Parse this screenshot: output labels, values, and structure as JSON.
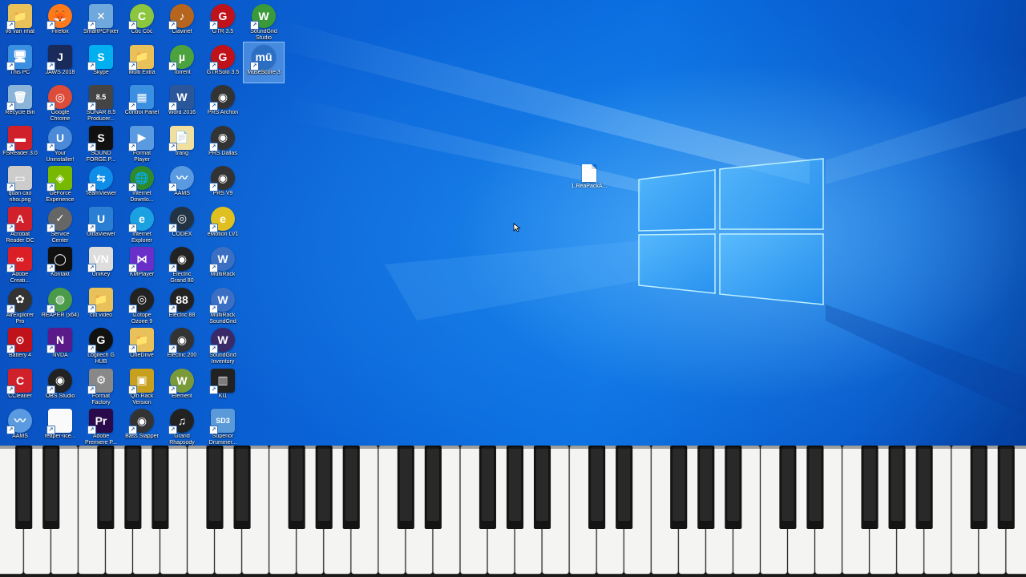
{
  "colors": {
    "desktop_blue": "#0a63d6",
    "logo_glow": "#8fd4ff",
    "white_key": "#f4f4f2",
    "black_key": "#141414"
  },
  "desktop_icons": [
    {
      "label": "vo van nhat",
      "icon": "user-folder-icon",
      "color": "#e8c15a",
      "glyph": "📁"
    },
    {
      "label": "Firefox",
      "icon": "firefox-icon",
      "color": "#ff7a1a",
      "glyph": "🦊",
      "round": true
    },
    {
      "label": "SmartPCFixer",
      "icon": "smartpcfixer-icon",
      "color": "#6fa8dc",
      "glyph": "✕"
    },
    {
      "label": "Cốc Cốc",
      "icon": "coccoc-icon",
      "color": "#8cc63f",
      "glyph": "C",
      "round": true
    },
    {
      "label": "Clavinet",
      "icon": "clavinet-icon",
      "color": "#b5651d",
      "glyph": "♪",
      "round": true
    },
    {
      "label": "GTR 3.5",
      "icon": "gtr-icon",
      "color": "#c0121a",
      "glyph": "G",
      "round": true
    },
    {
      "label": "SoundGrid",
      "label2": "Studio",
      "icon": "soundgrid-studio-icon",
      "color": "#3a9a3a",
      "glyph": "W",
      "round": true
    },
    {
      "label": "This PC",
      "icon": "this-pc-icon",
      "color": "#3b8fe0",
      "glyph": "🖥"
    },
    {
      "label": "JAWS 2018",
      "icon": "jaws-icon",
      "color": "#1a2a5a",
      "glyph": "J"
    },
    {
      "label": "Skype",
      "icon": "skype-icon",
      "color": "#00aff0",
      "glyph": "S"
    },
    {
      "label": "Multi Extra",
      "icon": "multi-extra-icon",
      "color": "#e8c15a",
      "glyph": "📁"
    },
    {
      "label": "Torrent",
      "icon": "utorrent-icon",
      "color": "#4ca33d",
      "glyph": "µ",
      "round": true
    },
    {
      "label": "GTRSolo 3.5",
      "icon": "gtrsolo-icon",
      "color": "#c0121a",
      "glyph": "G",
      "round": true
    },
    {
      "label": "MuseScore 3",
      "icon": "musescore-icon",
      "color": "#2a6fc4",
      "glyph": "mū",
      "round": true,
      "selected": true
    },
    {
      "label": "Recycle Bin",
      "icon": "recycle-bin-icon",
      "color": "#8ab4d8",
      "glyph": "🗑"
    },
    {
      "label": "Google",
      "label2": "Chrome",
      "icon": "chrome-icon",
      "color": "#dd4b39",
      "glyph": "◎",
      "round": true
    },
    {
      "label": "SONAR 8.5",
      "label2": "Producer...",
      "icon": "sonar-icon",
      "color": "#444",
      "glyph": "8.5"
    },
    {
      "label": "Control Panel",
      "icon": "control-panel-icon",
      "color": "#3b8fe0",
      "glyph": "▦"
    },
    {
      "label": "Word 2016",
      "icon": "word-icon",
      "color": "#2b579a",
      "glyph": "W"
    },
    {
      "label": "PRS Archon",
      "icon": "prs-archon-icon",
      "color": "#333",
      "glyph": "◉",
      "round": true
    },
    {
      "label": "FSReader 3.0",
      "icon": "fsreader-icon",
      "color": "#d0202a",
      "glyph": "▬"
    },
    {
      "label": "Your",
      "label2": "Uninstaller!",
      "icon": "uninstaller-icon",
      "color": "#4a8ad8",
      "glyph": "U",
      "round": true
    },
    {
      "label": "SOUND",
      "label2": "FORGE P...",
      "icon": "soundforge-icon",
      "color": "#111",
      "glyph": "S"
    },
    {
      "label": "Format",
      "label2": "Player",
      "icon": "format-player-icon",
      "color": "#5a9ae0",
      "glyph": "▶"
    },
    {
      "label": "trang",
      "icon": "trang-folder-icon",
      "color": "#f1dfa0",
      "glyph": "📄"
    },
    {
      "label": "PRS Dallas",
      "icon": "prs-dallas-icon",
      "color": "#333",
      "glyph": "◉",
      "round": true
    },
    {
      "label": "quan cao",
      "label2": "nhoi.png",
      "icon": "image-file-icon",
      "color": "#ccc",
      "glyph": "▭"
    },
    {
      "label": "GeForce",
      "label2": "Experience",
      "icon": "geforce-icon",
      "color": "#76b900",
      "glyph": "◈"
    },
    {
      "label": "TeamViewer",
      "icon": "teamviewer-icon",
      "color": "#0e8ee9",
      "glyph": "⇆",
      "round": true
    },
    {
      "label": "Internet",
      "label2": "Downlo...",
      "icon": "idm-icon",
      "color": "#2d8b2d",
      "glyph": "🌐",
      "round": true
    },
    {
      "label": "AAMS",
      "icon": "aams-icon",
      "color": "#5a9ae0",
      "glyph": "〰",
      "round": true
    },
    {
      "label": "PRS V9",
      "icon": "prs-v9-icon",
      "color": "#333",
      "glyph": "◉",
      "round": true
    },
    {
      "label": "Acrobat",
      "label2": "Reader DC",
      "icon": "acrobat-icon",
      "color": "#d0202a",
      "glyph": "A"
    },
    {
      "label": "Service",
      "label2": "Center",
      "icon": "service-center-icon",
      "color": "#666",
      "glyph": "✓",
      "round": true
    },
    {
      "label": "UltraViewer",
      "icon": "ultraviewer-icon",
      "color": "#2a7fd4",
      "glyph": "U"
    },
    {
      "label": "Internet",
      "label2": "Explorer",
      "icon": "ie-icon",
      "color": "#1ba1e2",
      "glyph": "e",
      "round": true
    },
    {
      "label": "CODEX",
      "icon": "codex-icon",
      "color": "#234",
      "glyph": "◎",
      "round": true
    },
    {
      "label": "eMotion LV1",
      "icon": "emotion-icon",
      "color": "#e0c020",
      "glyph": "e",
      "round": true
    },
    {
      "label": "Adobe",
      "label2": "Creati...",
      "icon": "creative-cloud-icon",
      "color": "#da1f26",
      "glyph": "∞"
    },
    {
      "label": "Kontakt",
      "icon": "kontakt-icon",
      "color": "#111",
      "glyph": "◯"
    },
    {
      "label": "UniKey",
      "icon": "unikey-icon",
      "color": "#ddd",
      "glyph": "VN"
    },
    {
      "label": "KMPlayer",
      "icon": "kmplayer-icon",
      "color": "#6b2fc9",
      "glyph": "⋈"
    },
    {
      "label": "Electric",
      "label2": "Grand 80",
      "icon": "electric-grand-icon",
      "color": "#222",
      "glyph": "◉",
      "round": true
    },
    {
      "label": "MultiRack",
      "icon": "multirack-icon",
      "color": "#3a6fc4",
      "glyph": "W",
      "round": true
    },
    {
      "label": "AirExplorer",
      "label2": "Pro",
      "icon": "airexplorer-icon",
      "color": "#333",
      "glyph": "✿",
      "round": true
    },
    {
      "label": "REAPER (x64)",
      "icon": "reaper-icon",
      "color": "#4a9a4a",
      "glyph": "◍",
      "round": true
    },
    {
      "label": "cut video",
      "icon": "cut-video-folder-icon",
      "color": "#e8c15a",
      "glyph": "📁"
    },
    {
      "label": "iZotope",
      "label2": "Ozone 9",
      "icon": "ozone-icon",
      "color": "#222",
      "glyph": "◎",
      "round": true
    },
    {
      "label": "Electric 88",
      "icon": "electric-88-icon",
      "color": "#222",
      "glyph": "88",
      "round": true
    },
    {
      "label": "MultiRack",
      "label2": "SoundGrid",
      "icon": "multirack-soundgrid-icon",
      "color": "#3a6fc4",
      "glyph": "W",
      "round": true
    },
    {
      "label": "Battery 4",
      "icon": "battery-icon",
      "color": "#c0121a",
      "glyph": "⊙"
    },
    {
      "label": "NVDA",
      "icon": "nvda-icon",
      "color": "#5a1a8a",
      "glyph": "N"
    },
    {
      "label": "Logitech G",
      "label2": "HUB",
      "icon": "logitech-icon",
      "color": "#111",
      "glyph": "G",
      "round": true
    },
    {
      "label": "OneDrive",
      "icon": "onedrive-folder-icon",
      "color": "#e8c15a",
      "glyph": "📁"
    },
    {
      "label": "Electric 200",
      "icon": "electric-200-icon",
      "color": "#333",
      "glyph": "◉",
      "round": true
    },
    {
      "label": "SoundGrid",
      "label2": "Inventory",
      "icon": "soundgrid-inventory-icon",
      "color": "#3a2a6a",
      "glyph": "W",
      "round": true
    },
    {
      "label": "CCleaner",
      "icon": "ccleaner-icon",
      "color": "#d0202a",
      "glyph": "C"
    },
    {
      "label": "OBS Studio",
      "icon": "obs-icon",
      "color": "#222",
      "glyph": "◉",
      "round": true
    },
    {
      "label": "Format",
      "label2": "Factory",
      "icon": "format-factory-icon",
      "color": "#888",
      "glyph": "⚙"
    },
    {
      "label": "Qin Rack",
      "label2": "Version",
      "icon": "qin-rack-icon",
      "color": "#c8a020",
      "glyph": "▣"
    },
    {
      "label": "Element",
      "icon": "element-icon",
      "color": "#7a9a3a",
      "glyph": "W",
      "round": true
    },
    {
      "label": "KI1",
      "icon": "ki1-icon",
      "color": "#222",
      "glyph": "▥"
    },
    {
      "label": "AAMS",
      "icon": "aams-2-icon",
      "color": "#5a9ae0",
      "glyph": "〰",
      "round": true
    },
    {
      "label": "reaper-lice...",
      "icon": "text-file-icon",
      "color": "#fafafa",
      "glyph": ""
    },
    {
      "label": "Adobe",
      "label2": "Premiere P...",
      "icon": "premiere-icon",
      "color": "#2a0a4a",
      "glyph": "Pr"
    },
    {
      "label": "Bass Slapper",
      "icon": "bass-slapper-icon",
      "color": "#333",
      "glyph": "◉",
      "round": true
    },
    {
      "label": "Grand",
      "label2": "Rhapsody",
      "icon": "grand-rhapsody-icon",
      "color": "#222",
      "glyph": "♫",
      "round": true
    },
    {
      "label": "Superior",
      "label2": "Drummer...",
      "icon": "superior-drummer-icon",
      "color": "#5a9ad8",
      "glyph": "SD3"
    }
  ],
  "desktop_file": {
    "label": "1.ReaPackA...",
    "icon": "document-file-icon"
  }
}
